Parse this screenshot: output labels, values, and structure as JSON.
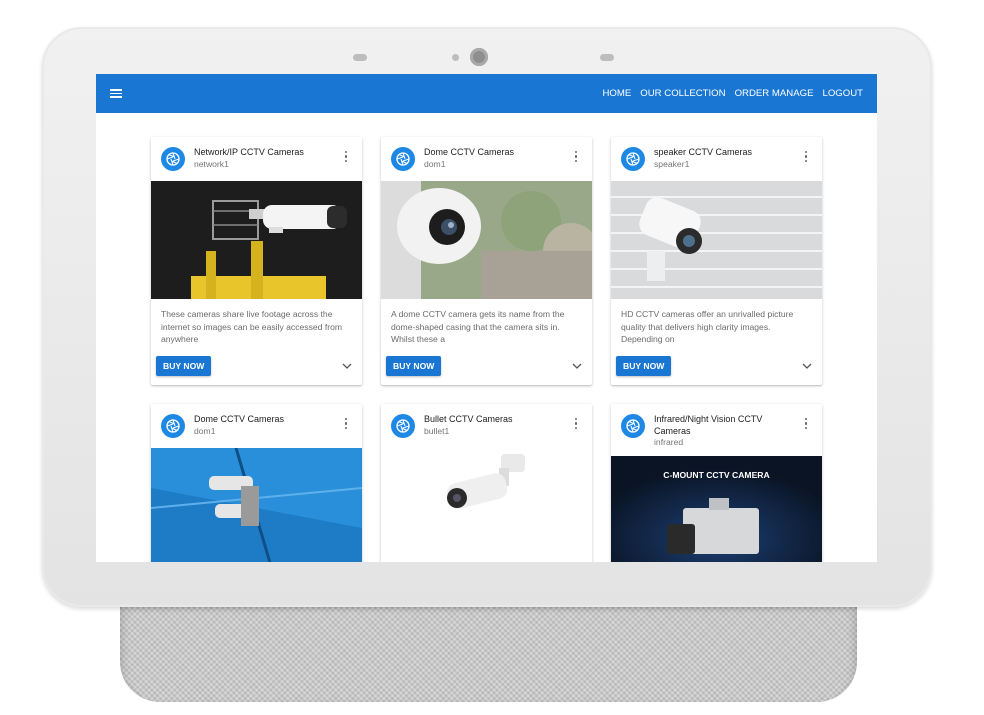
{
  "nav": {
    "items": [
      "HOME",
      "OUR COLLECTION",
      "ORDER MANAGE",
      "LOGOUT"
    ]
  },
  "cards": [
    {
      "title": "Network/IP CCTV Cameras",
      "subtitle": "network1",
      "description": "These cameras share live footage across the internet so images can be easily accessed from anywhere",
      "button": "BUY NOW"
    },
    {
      "title": "Dome CCTV Cameras",
      "subtitle": "dom1",
      "description": "A dome CCTV camera gets its name from the dome-shaped casing that the camera sits in. Whilst these a",
      "button": "BUY NOW"
    },
    {
      "title": "speaker CCTV Cameras",
      "subtitle": "speaker1",
      "description": "HD CCTV cameras offer an unrivalled picture quality that delivers high clarity images. Depending on",
      "button": "BUY NOW"
    },
    {
      "title": "Dome CCTV Cameras",
      "subtitle": "dom1"
    },
    {
      "title": "Bullet CCTV Cameras",
      "subtitle": "bullet1"
    },
    {
      "title": "Infrared/Night Vision CCTV Cameras",
      "subtitle": "infrared",
      "image_text": "C-MOUNT CCTV CAMERA"
    }
  ],
  "colors": {
    "appbar": "#1976d2",
    "avatar": "#1e88e5",
    "button": "#1976d2"
  },
  "icons": {
    "menu": "menu-icon",
    "avatar": "camera-aperture-icon",
    "more": "more-vert-icon",
    "expand": "chevron-down-icon"
  }
}
